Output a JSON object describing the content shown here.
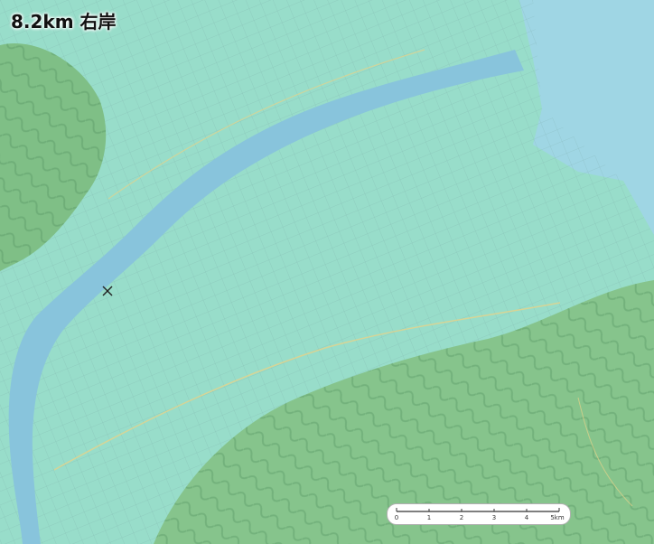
{
  "map": {
    "title": "8.2km 右岸",
    "marker": {
      "name": "location-marker",
      "symbol": "×"
    },
    "scale_bar": {
      "ticks": [
        "0",
        "1",
        "2",
        "3",
        "4",
        "5km"
      ]
    },
    "colors": {
      "water": "#9fd6e4",
      "river": "#88c4dc",
      "lowland": "#98ddca",
      "mountain": "#7fbf86",
      "road": "#7aa8a4"
    }
  }
}
